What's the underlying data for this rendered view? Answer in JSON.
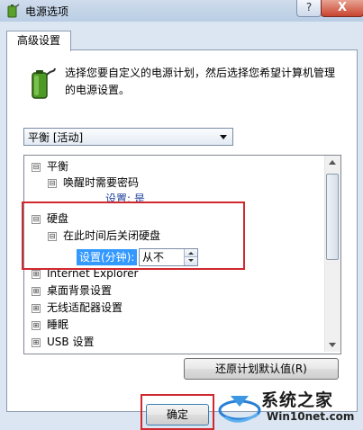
{
  "window": {
    "title": "电源选项",
    "help_label": "?",
    "close_label": "X"
  },
  "tab": {
    "label": "高级设置"
  },
  "description": "选择您要自定义的电源计划，然后选择您希望计算机管理的电源设置。",
  "plan_select": {
    "value": "平衡 [活动]"
  },
  "tree": {
    "items": [
      {
        "label": "平衡",
        "expander": "⊟"
      },
      {
        "label": "唤醒时需要密码",
        "expander": "⊟"
      },
      {
        "label": "设置: 是"
      },
      {
        "label": "硬盘",
        "expander": "⊟"
      },
      {
        "label": "在此时间后关闭硬盘",
        "expander": "⊟"
      },
      {
        "label": "Internet Explorer",
        "expander": "⊞"
      },
      {
        "label": "桌面背景设置",
        "expander": "⊞"
      },
      {
        "label": "无线适配器设置",
        "expander": "⊞"
      },
      {
        "label": "睡眠",
        "expander": "⊞"
      },
      {
        "label": "USB 设置",
        "expander": "⊞"
      }
    ],
    "setting_label": "设置(分钟):",
    "setting_value": "从不"
  },
  "buttons": {
    "restore_defaults": "还原计划默认值(R)",
    "ok": "确定"
  },
  "watermark": {
    "name": "系统之家",
    "url": "Win10net.com"
  },
  "colors": {
    "highlight": "#d0282e",
    "selection": "#3399ff"
  }
}
